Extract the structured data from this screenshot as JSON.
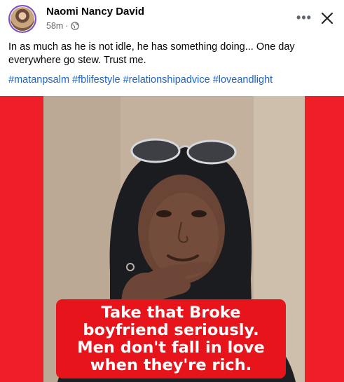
{
  "post": {
    "author": "Naomi Nancy David",
    "time": "58m",
    "separator": "·",
    "text": "In as much as he is not idle, he has something doing... One day everywhere go stew. Trust me.",
    "hashtags": [
      "#matanpsalm",
      "#fblifestyle",
      "#relationshipadvice",
      "#loveandlight"
    ],
    "link_color": "#1a64c8"
  },
  "header_actions": {
    "more_label": "•••",
    "more_icon": "more-horizontal-icon",
    "close_icon": "close-icon"
  },
  "media": {
    "background_color": "#ee1f28",
    "caption": "Take that Broke boyfriend seriously. Men don't fall in love when they're rich."
  }
}
